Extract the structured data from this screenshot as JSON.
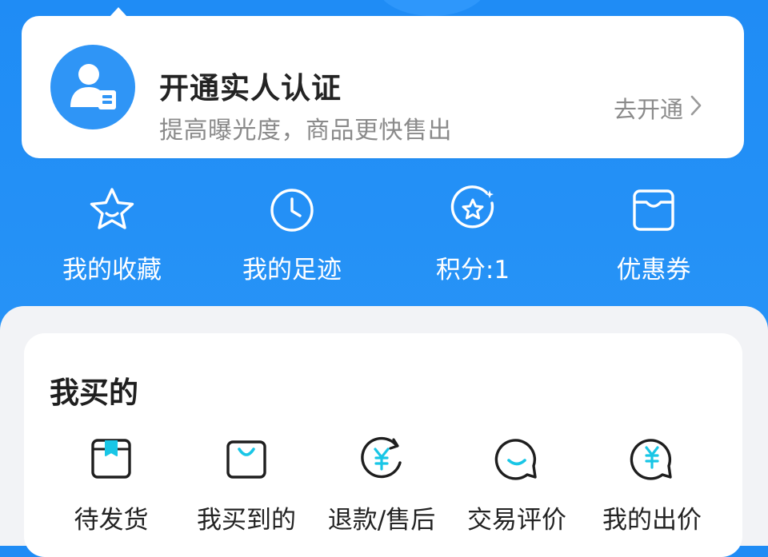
{
  "verify": {
    "title": "开通实人认证",
    "subtitle": "提高曝光度，商品更快售出",
    "action": "去开通"
  },
  "quick": {
    "items": [
      {
        "label": "我的收藏",
        "icon": "star-icon"
      },
      {
        "label": "我的足迹",
        "icon": "clock-icon"
      },
      {
        "label": "积分:1",
        "icon": "points-star-icon"
      },
      {
        "label": "优惠券",
        "icon": "coupon-wallet-icon"
      }
    ]
  },
  "bought": {
    "title": "我买的",
    "items": [
      {
        "label": "待发货",
        "icon": "box-icon"
      },
      {
        "label": "我买到的",
        "icon": "shopping-bag-icon"
      },
      {
        "label": "退款/售后",
        "icon": "refund-yen-icon"
      },
      {
        "label": "交易评价",
        "icon": "review-bubble-icon"
      },
      {
        "label": "我的出价",
        "icon": "bid-bubble-icon"
      }
    ]
  },
  "colors": {
    "primary": "#1f8cf5",
    "accent_cyan": "#19c6e6",
    "card_bg": "#ffffff",
    "panel_bg": "#f2f3f6"
  }
}
